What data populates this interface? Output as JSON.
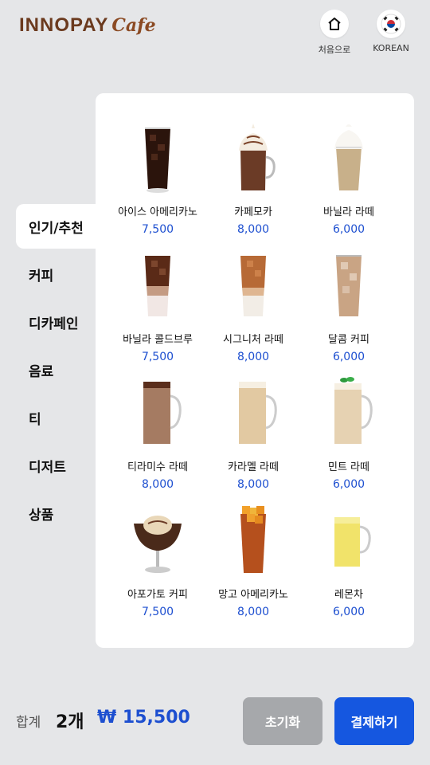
{
  "header": {
    "logo_text": "INNOPAY",
    "logo_cafe": "Cafe",
    "home_label": "처음으로",
    "home_icon": "home-icon",
    "lang_label": "KOREAN",
    "lang_icon": "korea-flag-icon"
  },
  "sidebar": {
    "items": [
      {
        "label": "인기/추천"
      },
      {
        "label": "커피"
      },
      {
        "label": "디카페인"
      },
      {
        "label": "음료"
      },
      {
        "label": "티"
      },
      {
        "label": "디저트"
      },
      {
        "label": "상품"
      }
    ],
    "active_index": 0
  },
  "menu": {
    "items": [
      {
        "name": "아이스 아메리카노",
        "price": "7,500",
        "image": "iced-americano"
      },
      {
        "name": "카페모카",
        "price": "8,000",
        "image": "cafe-mocha"
      },
      {
        "name": "바닐라 라떼",
        "price": "6,000",
        "image": "vanilla-latte"
      },
      {
        "name": "바닐라 콜드브루",
        "price": "7,500",
        "image": "vanilla-cold-brew"
      },
      {
        "name": "시그니처 라떼",
        "price": "8,000",
        "image": "signature-latte"
      },
      {
        "name": "달콤 커피",
        "price": "6,000",
        "image": "sweet-coffee"
      },
      {
        "name": "티라미수 라떼",
        "price": "8,000",
        "image": "tiramisu-latte"
      },
      {
        "name": "카라멜 라떼",
        "price": "8,000",
        "image": "caramel-latte"
      },
      {
        "name": "민트 라떼",
        "price": "6,000",
        "image": "mint-latte"
      },
      {
        "name": "아포가토 커피",
        "price": "7,500",
        "image": "affogato"
      },
      {
        "name": "망고 아메리카노",
        "price": "8,000",
        "image": "mango-americano"
      },
      {
        "name": "레몬차",
        "price": "6,000",
        "image": "lemon-tea"
      }
    ]
  },
  "footer": {
    "total_label": "합계",
    "total_count": "2개",
    "total_price": "₩ 15,500",
    "reset_label": "초기화",
    "pay_label": "결제하기"
  },
  "colors": {
    "accent": "#1557e0",
    "price": "#1d4fd0",
    "reset_button": "#a6a8ab",
    "background": "#e5e6e8"
  }
}
